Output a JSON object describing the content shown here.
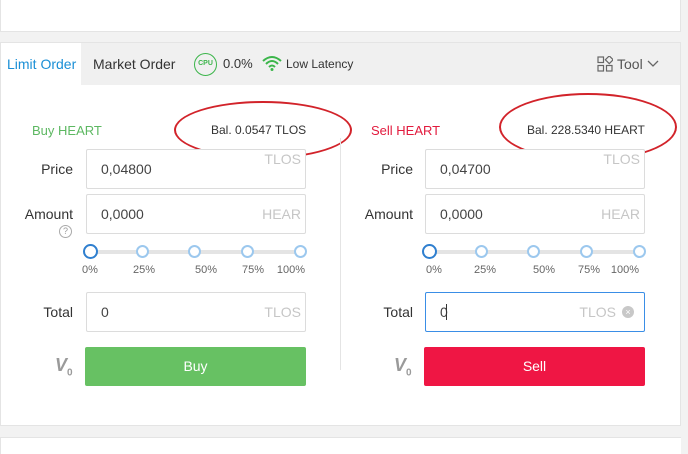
{
  "tabs": {
    "limit_order": "Limit Order",
    "market_order": "Market Order"
  },
  "status": {
    "cpu_label": "CPU",
    "cpu_value": "0.0%",
    "latency": "Low Latency"
  },
  "tool": {
    "label": "Tool"
  },
  "buy": {
    "title": "Buy HEART",
    "balance": "Bal. 0.0547 TLOS",
    "price_label": "Price",
    "price_value": "0,04800",
    "price_unit": "TLOS",
    "amount_label": "Amount",
    "amount_value": "0,0000",
    "amount_unit": "HEAR",
    "percent_marks": [
      "0%",
      "25%",
      "50%",
      "75%",
      "100%"
    ],
    "slider_value": 0,
    "total_label": "Total",
    "total_value": "0",
    "total_unit": "TLOS",
    "button": "Buy",
    "vip_badge": "V",
    "vip_level": "0"
  },
  "sell": {
    "title": "Sell HEART",
    "balance": "Bal. 228.5340 HEART",
    "price_label": "Price",
    "price_value": "0,04700",
    "price_unit": "TLOS",
    "amount_label": "Amount",
    "amount_value": "0,0000",
    "amount_unit": "HEAR",
    "percent_marks": [
      "0%",
      "25%",
      "50%",
      "75%",
      "100%"
    ],
    "slider_value": 0,
    "total_label": "Total",
    "total_value": "0",
    "total_unit": "TLOS",
    "button": "Sell",
    "vip_badge": "V",
    "vip_level": "0"
  },
  "colors": {
    "accent": "#1a8fd6",
    "buy": "#67c163",
    "sell": "#ef1644",
    "annotation": "#d2232a"
  },
  "icons": {
    "cpu": "cpu-icon",
    "wifi": "wifi-icon",
    "tool": "tool-grid-icon",
    "chevron": "chevron-down-icon",
    "help": "help-icon",
    "clear": "clear-icon",
    "vip": "vip-level-icon"
  }
}
